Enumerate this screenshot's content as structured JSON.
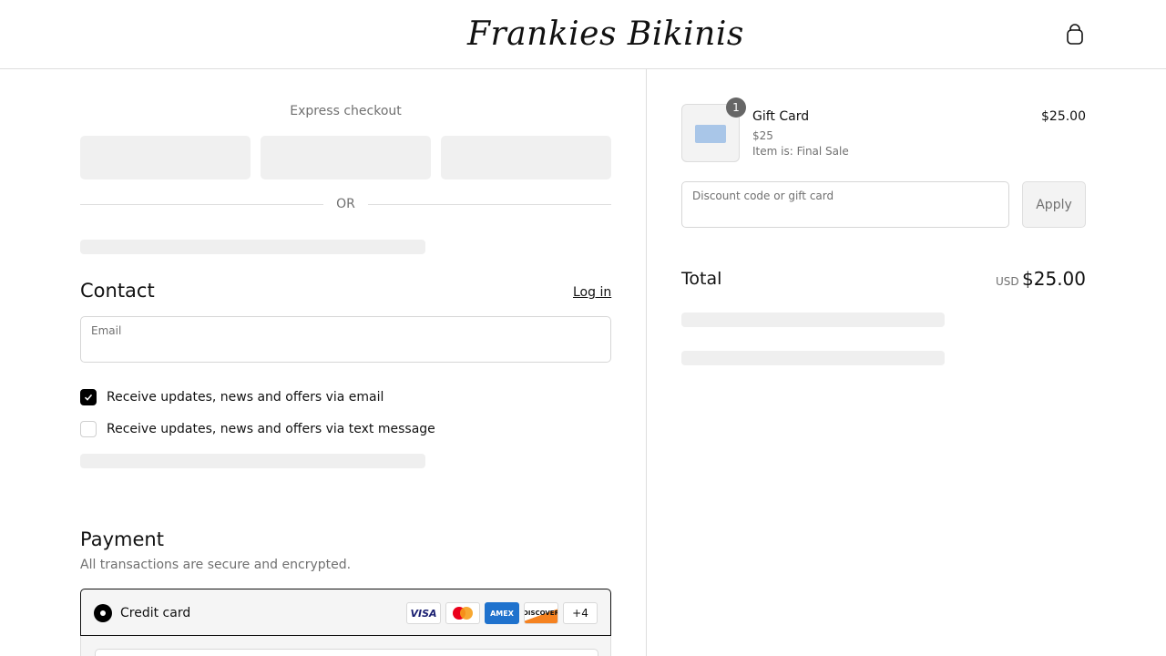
{
  "header": {
    "brand": "Frankies Bikinis",
    "cart_icon": "shopping-bag-icon"
  },
  "express_checkout": {
    "title": "Express checkout",
    "separator": "OR"
  },
  "contact": {
    "title": "Contact",
    "login_label": "Log in",
    "email_label": "Email",
    "options": [
      {
        "label": "Receive updates, news and offers via email",
        "checked": true
      },
      {
        "label": "Receive updates, news and offers via text message",
        "checked": false
      }
    ]
  },
  "payment": {
    "title": "Payment",
    "subtitle": "All transactions are secure and encrypted.",
    "method_label": "Credit card",
    "card_brands": [
      "VISA",
      "mastercard",
      "AMEX",
      "DISCOVER"
    ],
    "more_brands": "+4"
  },
  "order_summary": {
    "item": {
      "name": "Gift Card",
      "variant": "$25",
      "note": "Item is: Final Sale",
      "price": "$25.00",
      "quantity": "1"
    },
    "discount_label": "Discount code or gift card",
    "apply_label": "Apply",
    "total_label": "Total",
    "currency": "USD",
    "total_amount": "$25.00"
  },
  "colors": {
    "accent": "#000000",
    "muted_text": "#707070",
    "skeleton": "#efefef",
    "border": "#dedede"
  }
}
